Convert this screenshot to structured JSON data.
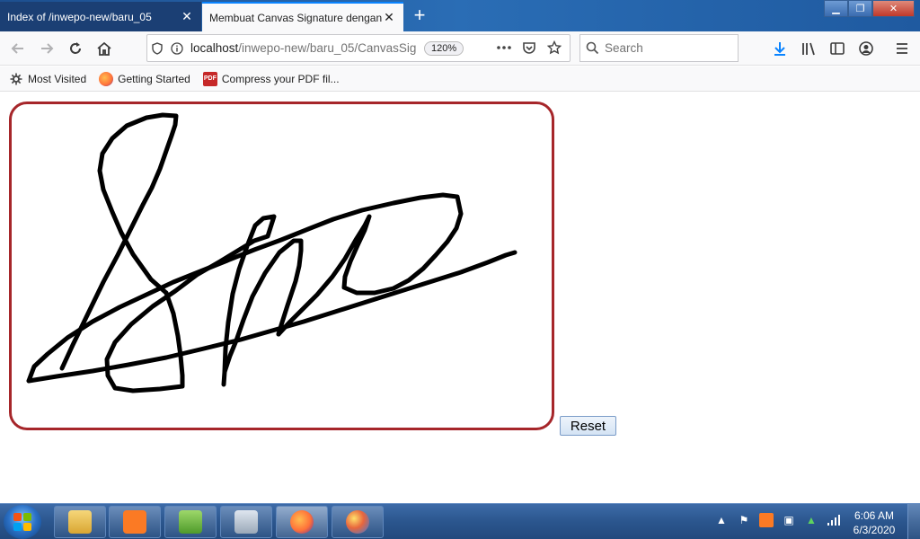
{
  "tabs": [
    {
      "title": "Index of /inwepo-new/baru_05",
      "close": "✕"
    },
    {
      "title": "Membuat Canvas Signature dengan",
      "close": "✕"
    }
  ],
  "newtab_label": "+",
  "window_controls": {
    "minimize": "▁",
    "restore": "❐",
    "close": "✕"
  },
  "urlbar": {
    "host": "localhost",
    "path": "/inwepo-new/baru_05/CanvasSig",
    "zoom": "120%"
  },
  "search": {
    "placeholder": "Search"
  },
  "bookmarks": [
    {
      "label": "Most Visited",
      "icon": "gear-icon"
    },
    {
      "label": "Getting Started",
      "icon": "firefox-icon"
    },
    {
      "label": "Compress your PDF fil...",
      "icon": "pdf-icon"
    }
  ],
  "pdf_icon_text": "PDF",
  "page": {
    "reset_label": "Reset"
  },
  "colors": {
    "pad_border": "#a6262a",
    "ink": "#000000"
  },
  "clock": {
    "time": "6:06 AM",
    "date": "6/3/2020"
  }
}
